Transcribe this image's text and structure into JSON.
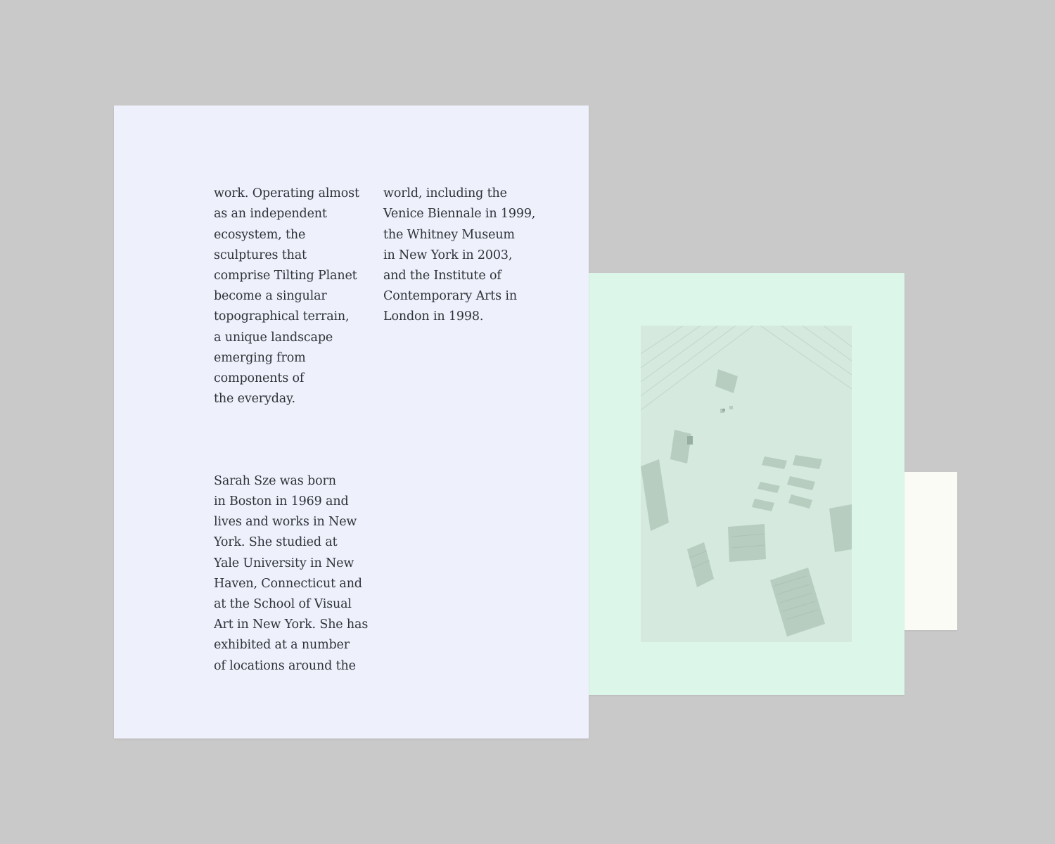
{
  "spread": {
    "column_left": {
      "paragraph_1": "work. Operating almost\nas an independent\necosystem, the\nsculptures that\ncomprise Tilting Planet\nbecome a singular\ntopographical terrain,\na unique landscape\nemerging from\ncomponents of\nthe everyday.",
      "paragraph_2": "Sarah Sze was born\nin Boston in 1969 and\nlives and works in New\nYork. She studied at\nYale University in New\nHaven, Connecticut and\nat the School of Visual\nArt in New York. She has\nexhibited at a number\nof locations around the"
    },
    "column_right": {
      "paragraph_1": "world, including the\nVenice Biennale in 1999,\nthe Whitney Museum\nin New York in 2003,\nand the Institute of\nContemporary Arts in\nLondon in 1998."
    }
  },
  "colors": {
    "background": "#c9c9c9",
    "main_page": "#eef1fb",
    "green_page": "#dcf6e9",
    "white_page": "#fbfbf6",
    "body_text": "#2e3338"
  }
}
